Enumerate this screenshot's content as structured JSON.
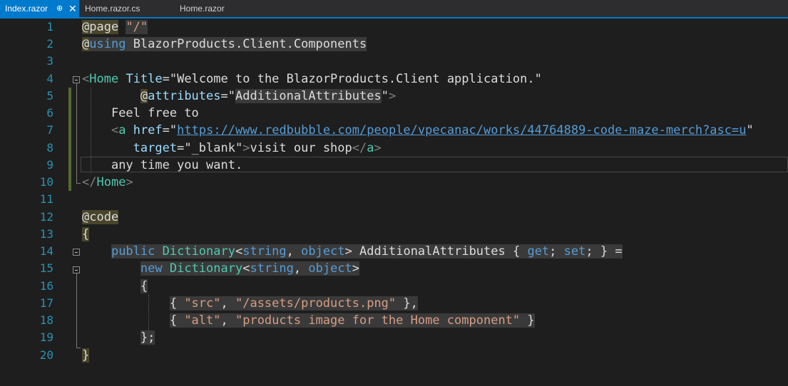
{
  "tabs": [
    {
      "label": "Index.razor",
      "active": true
    },
    {
      "label": "Home.razor.cs",
      "active": false
    },
    {
      "label": "Home.razor",
      "active": false
    }
  ],
  "tab_icons": {
    "pin": "pin-icon",
    "close": "close-icon"
  },
  "line_numbers": [
    "1",
    "2",
    "3",
    "4",
    "5",
    "6",
    "7",
    "8",
    "9",
    "10",
    "11",
    "12",
    "13",
    "14",
    "15",
    "16",
    "17",
    "18",
    "19",
    "20"
  ],
  "code": {
    "l1_at": "@page",
    "l1_route": "\"/\"",
    "l2_at": "@",
    "l2_using": "using",
    "l2_ns": "BlazorProducts.Client.Components",
    "l4_open": "<",
    "l4_tag": "Home",
    "l4_attr": "Title",
    "l4_eq": "=",
    "l4_val": "\"Welcome to the BlazorProducts.Client application.\"",
    "l5_at": "@",
    "l5_attr": "attributes",
    "l5_eq": "=",
    "l5_q1": "\"",
    "l5_val": "AdditionalAttributes",
    "l5_q2": "\"",
    "l5_close": ">",
    "l6_text": "Feel free to",
    "l7_open": "<",
    "l7_tag": "a",
    "l7_attr": "href",
    "l7_eq": "=",
    "l7_q1": "\"",
    "l7_url": "https://www.redbubble.com/people/vpecanac/works/44764889-code-maze-merch?asc=u",
    "l7_q2": "\"",
    "l8_attr": "target",
    "l8_eq": "=",
    "l8_val": "\"_blank\"",
    "l8_gt": ">",
    "l8_text": "visit our shop",
    "l8_close_open": "</",
    "l8_close_tag": "a",
    "l8_close_gt": ">",
    "l9_text": "any time you want.",
    "l10_open": "</",
    "l10_tag": "Home",
    "l10_gt": ">",
    "l12_code": "@code",
    "l13_brace": "{",
    "l14_public": "public",
    "l14_dict": "Dictionary",
    "l14_lt": "<",
    "l14_string": "string",
    "l14_comma": ", ",
    "l14_object": "object",
    "l14_gt": ">",
    "l14_name": " AdditionalAttributes { ",
    "l14_get": "get",
    "l14_semi": "; ",
    "l14_set": "set",
    "l14_end": "; } =",
    "l15_new": "new",
    "l15_dict": "Dictionary",
    "l15_lt": "<",
    "l15_string": "string",
    "l15_comma": ", ",
    "l15_object": "object",
    "l15_gt": ">",
    "l16_brace": "{",
    "l17_open": "{ ",
    "l17_key": "\"src\"",
    "l17_comma": ", ",
    "l17_val": "\"/assets/products.png\"",
    "l17_close": " },",
    "l18_open": "{ ",
    "l18_key": "\"alt\"",
    "l18_comma": ", ",
    "l18_val": "\"products image for the Home component\"",
    "l18_close": " }",
    "l19_brace": "};",
    "l20_brace": "}"
  },
  "colors": {
    "background": "#1e1e1e",
    "tab_accent": "#007acc",
    "keyword": "#569cd6",
    "type": "#4ec9b0",
    "string": "#d69d85",
    "attribute": "#9cdcfe",
    "line_number": "#2b91af",
    "razor_highlight": "#48452b"
  }
}
